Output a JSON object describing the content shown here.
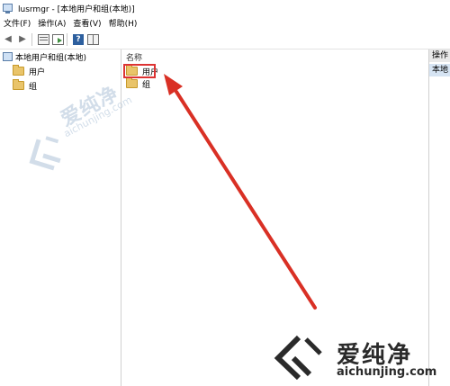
{
  "window": {
    "title": "lusrmgr - [本地用户和组(本地)]"
  },
  "menu": {
    "items": [
      "文件(F)",
      "操作(A)",
      "查看(V)",
      "帮助(H)"
    ]
  },
  "tree": {
    "root_label": "本地用户和组(本地)",
    "children": [
      "用户",
      "组"
    ]
  },
  "list": {
    "column_header": "名称",
    "rows": [
      "用户",
      "组"
    ]
  },
  "actions": {
    "header": "操作",
    "subheader": "本地"
  },
  "watermark": {
    "brand_cn": "爱纯净",
    "url": "aichunjing.com"
  },
  "colors": {
    "annotation_red": "#d93025",
    "folder": "#e9c46a",
    "selection": "#d6e4f3"
  },
  "icons": {
    "app": "computer-management-icon",
    "back": "back-arrow-icon",
    "forward": "forward-arrow-icon",
    "show_hide_tree": "console-tree-icon",
    "export": "export-list-icon",
    "help": "help-icon",
    "properties": "properties-grid-icon",
    "folder": "folder-icon"
  }
}
